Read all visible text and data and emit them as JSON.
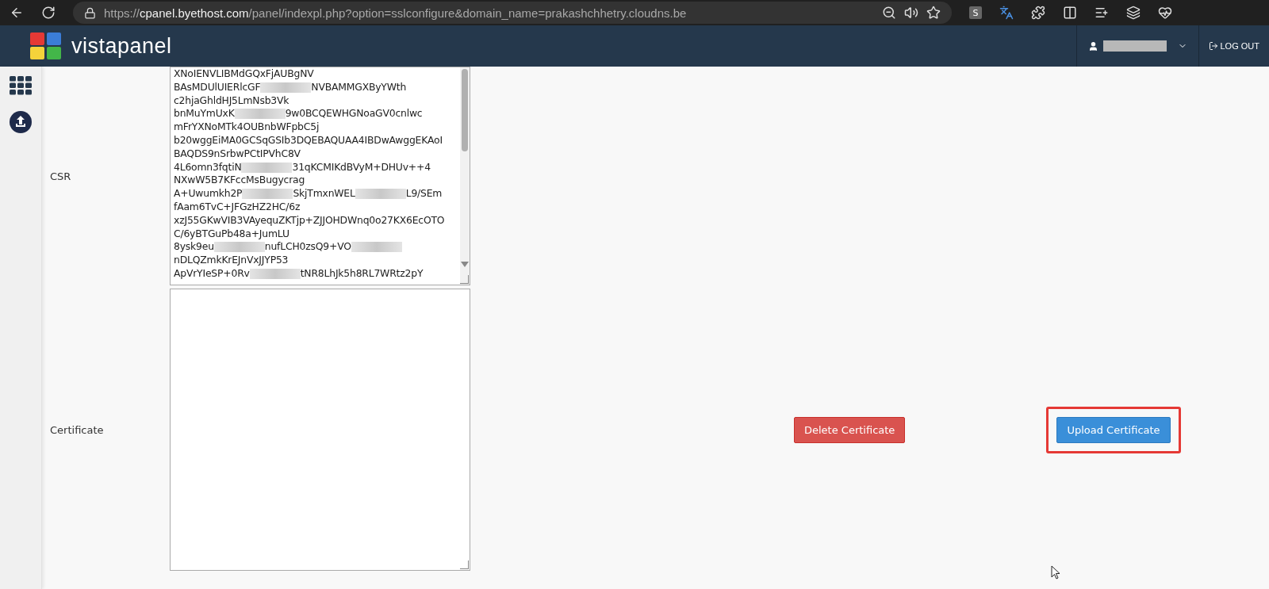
{
  "browser": {
    "url_prefix": "https://",
    "url_host": "cpanel.byethost.com",
    "url_rest": "/panel/indexpl.php?option=sslconfigure&domain_name=prakashchhetry.cloudns.be",
    "extension_label": "S"
  },
  "header": {
    "logo_word": "vista",
    "logo_word2": "panel",
    "logout": "LOG OUT"
  },
  "form": {
    "csr_label": "CSR",
    "csr_lines": [
      [
        {
          "kind": "text",
          "text": "XNoIENVLIBMdGQxFjAUBgNV"
        }
      ],
      [
        {
          "kind": "text",
          "text": "BAsMDUlUIERlcGF"
        },
        {
          "kind": "redacted"
        },
        {
          "kind": "text",
          "text": "NVBAMMGXByYWth"
        }
      ],
      [
        {
          "kind": "text",
          "text": "c2hjaGhldHJ5LmNsb3Vk"
        }
      ],
      [
        {
          "kind": "text",
          "text": "bnMuYmUxK"
        },
        {
          "kind": "redacted"
        },
        {
          "kind": "text",
          "text": "9w0BCQEWHGNoaGV0cnlwc"
        }
      ],
      [
        {
          "kind": "text",
          "text": "mFrYXNoMTk4OUBnbWFpbC5j"
        }
      ],
      [
        {
          "kind": "text",
          "text": "b20wggEiMA0GCSqGSIb3DQEBAQUAA4IBDwAwggEKAoI"
        }
      ],
      [
        {
          "kind": "text",
          "text": "BAQDS9nSrbwPCtIPVhC8V"
        }
      ],
      [
        {
          "kind": "text",
          "text": "4L6omn3fqtiN"
        },
        {
          "kind": "redacted"
        },
        {
          "kind": "text",
          "text": "31qKCMIKdBVyM+DHUv++4"
        }
      ],
      [
        {
          "kind": "text",
          "text": "NXwW5B7KFccMsBugycrag"
        }
      ],
      [
        {
          "kind": "text",
          "text": "A+Uwumkh2P"
        },
        {
          "kind": "redacted"
        },
        {
          "kind": "text",
          "text": "SkjTmxnWEL"
        },
        {
          "kind": "redacted"
        },
        {
          "kind": "text",
          "text": "L9/SEm"
        }
      ],
      [
        {
          "kind": "text",
          "text": "fAam6TvC+JFGzHZ2HC/6z"
        }
      ],
      [
        {
          "kind": "text",
          "text": "xzJ55GKwVIB3VAyequZKTjp+ZJJOHDWnq0o27KX6EcOTO"
        }
      ],
      [
        {
          "kind": "text",
          "text": "C/6yBTGuPb48a+JumLU"
        }
      ],
      [
        {
          "kind": "text",
          "text": "8ysk9eu"
        },
        {
          "kind": "redacted"
        },
        {
          "kind": "text",
          "text": "nufLCH0zsQ9+VO"
        },
        {
          "kind": "redacted"
        }
      ],
      [
        {
          "kind": "text",
          "text": "nDLQZmkKrEJnVxJJYP53"
        }
      ],
      [
        {
          "kind": "text",
          "text": "ApVrYIeSP+0Rv"
        },
        {
          "kind": "redacted"
        },
        {
          "kind": "text",
          "text": "tNR8LhJk5h8RL7WRtz2pY"
        }
      ]
    ],
    "certificate_label": "Certificate",
    "buttons": [
      {
        "kind": "danger",
        "label": "Delete Certificate",
        "highlighted": false
      },
      {
        "kind": "primary",
        "label": "Upload Certificate",
        "highlighted": true
      }
    ]
  }
}
